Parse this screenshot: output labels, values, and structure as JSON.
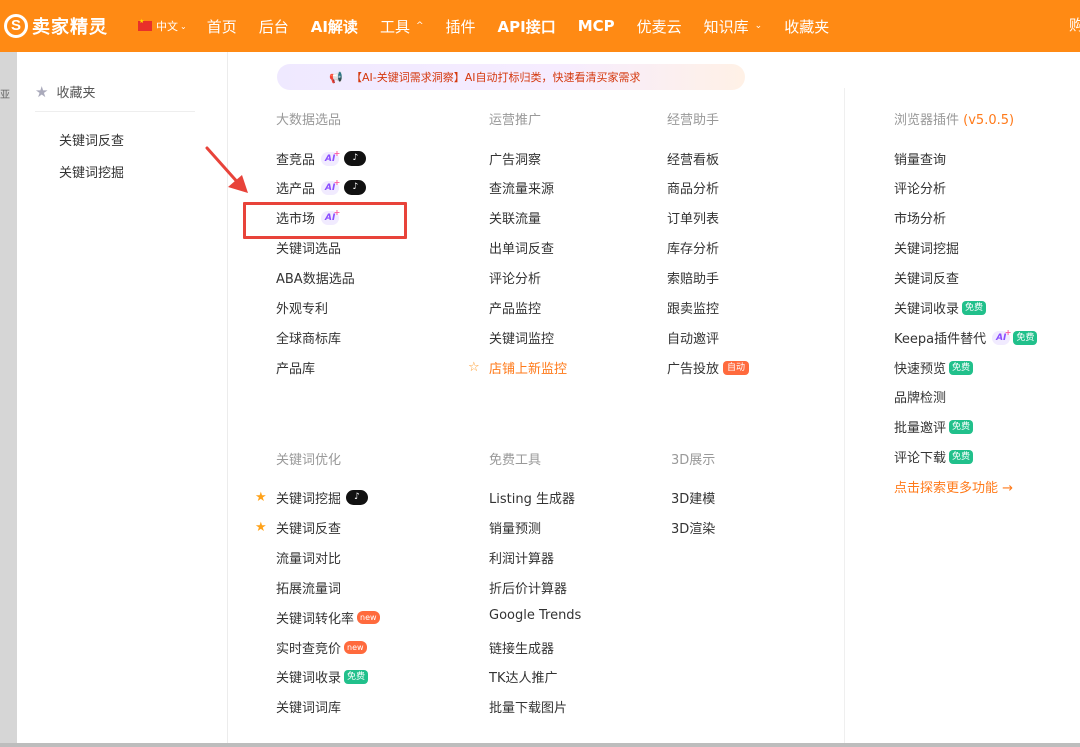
{
  "topbar": {
    "logo_mark": "S",
    "logo_text": "卖家精灵",
    "lang": "中文",
    "nav": [
      "首页",
      "后台",
      "AI解读",
      "工具",
      "插件",
      "API接口",
      "MCP",
      "优麦云",
      "知识库",
      "收藏夹"
    ],
    "nav_cut": "购"
  },
  "left_strip_frag": "亚",
  "sidebar": {
    "heading": "收藏夹",
    "links": [
      "关键词反查",
      "关键词挖掘"
    ]
  },
  "banner": {
    "text": "【AI-关键词需求洞察】AI自动打标归类，快速看清买家需求"
  },
  "sections": {
    "big_data": {
      "title": "大数据选品",
      "items": [
        "查竞品",
        "选产品",
        "选市场",
        "关键词选品",
        "ABA数据选品",
        "外观专利",
        "全球商标库",
        "产品库"
      ]
    },
    "promotion": {
      "title": "运营推广",
      "items": [
        "广告洞察",
        "查流量来源",
        "关联流量",
        "出单词反查",
        "评论分析",
        "产品监控",
        "关键词监控",
        "店铺上新监控"
      ]
    },
    "assistant": {
      "title": "经营助手",
      "items": [
        "经营看板",
        "商品分析",
        "订单列表",
        "库存分析",
        "索赔助手",
        "跟卖监控",
        "自动邀评",
        "广告投放"
      ]
    },
    "browser": {
      "title": "浏览器插件",
      "version": "(v5.0.5)",
      "items": [
        "销量查询",
        "评论分析",
        "市场分析",
        "关键词挖掘",
        "关键词反查",
        "关键词收录",
        "Keepa插件替代",
        "快速预览",
        "品牌检测",
        "批量邀评",
        "评论下载"
      ],
      "more": "点击探索更多功能 →"
    },
    "keyword_opt": {
      "title": "关键词优化",
      "items": [
        "关键词挖掘",
        "关键词反查",
        "流量词对比",
        "拓展流量词",
        "关键词转化率",
        "实时查竞价",
        "关键词收录",
        "关键词词库"
      ]
    },
    "free_tools": {
      "title": "免费工具",
      "items": [
        "Listing 生成器",
        "销量预测",
        "利润计算器",
        "折后价计算器",
        "Google Trends",
        "链接生成器",
        "TK达人推广",
        "批量下载图片"
      ]
    },
    "three_d": {
      "title": "3D展示",
      "items": [
        "3D建模",
        "3D渲染"
      ]
    }
  },
  "badges": {
    "ai": "AI",
    "tiktok": "♪",
    "free": "免费",
    "new": "new",
    "auto": "自动"
  },
  "colors": {
    "brand": "#ff8a14",
    "accent": "#ff7a1a",
    "free": "#21c08b",
    "highlight": "#e8433a"
  }
}
